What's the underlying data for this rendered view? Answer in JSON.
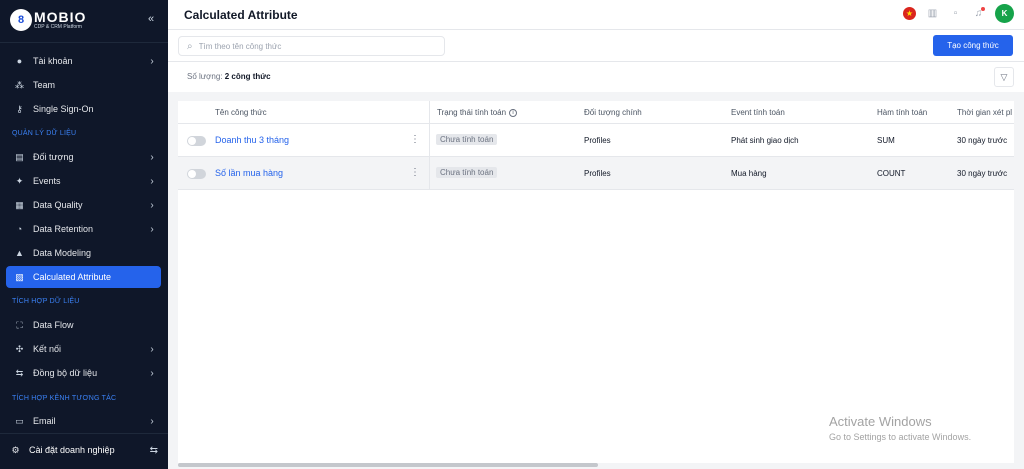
{
  "app": {
    "logo_name": "MOBIO",
    "logo_sub": "CDP & CRM Platform",
    "logo_mark": "8"
  },
  "sidebar": {
    "collapse_icon": "chevrons-left-icon",
    "items": [
      {
        "label": "Tài khoản",
        "icon": "user-icon"
      },
      {
        "label": "Team",
        "icon": "team-icon"
      },
      {
        "label": "Single Sign-On",
        "icon": "key-icon"
      },
      {
        "label": "Đối tượng",
        "icon": "object-icon"
      },
      {
        "label": "Events",
        "icon": "events-icon"
      },
      {
        "label": "Data Quality",
        "icon": "data-quality-icon"
      },
      {
        "label": "Data Retention",
        "icon": "data-retention-icon"
      },
      {
        "label": "Data Modeling",
        "icon": "data-modeling-icon"
      },
      {
        "label": "Calculated Attribute",
        "icon": "calculated-attribute-icon"
      },
      {
        "label": "Data Flow",
        "icon": "data-flow-icon"
      },
      {
        "label": "Kết nối",
        "icon": "connect-icon"
      },
      {
        "label": "Đồng bộ dữ liệu",
        "icon": "sync-icon"
      },
      {
        "label": "Email",
        "icon": "email-icon"
      }
    ],
    "sections": {
      "data_management": "QUẢN LÝ DỮ LIỆU",
      "data_integration": "TÍCH HỢP DỮ LIỆU",
      "channel_integration": "TÍCH HỢP KÊNH TƯƠNG TÁC"
    },
    "settings_label": "Cài đặt doanh nghiệp"
  },
  "header": {
    "title": "Calculated Attribute",
    "avatar_letter": "K",
    "colors": {
      "flag": "#da251d",
      "avatar": "#16a34a"
    }
  },
  "toolbar": {
    "search_placeholder": "Tìm theo tên công thức",
    "search_value": "",
    "create_label": "Tạo công thức",
    "accent": "#2563eb"
  },
  "summary": {
    "count_label": "Số lượng:",
    "count_value": "2 công thức"
  },
  "table": {
    "columns": [
      "Tên công thức",
      "Trạng thái tính toán",
      "Đối tượng chính",
      "Event tính toán",
      "Hàm tính toán",
      "Thời gian xét pl"
    ],
    "rows": [
      {
        "name": "Doanh thu 3 tháng",
        "status": "Chưa tính toán",
        "object": "Profiles",
        "event": "Phát sinh giao dịch",
        "func": "SUM",
        "time": "30 ngày trước",
        "enabled": false
      },
      {
        "name": "Số lần mua hàng",
        "status": "Chưa tính toán",
        "object": "Profiles",
        "event": "Mua hàng",
        "func": "COUNT",
        "time": "30 ngày trước",
        "enabled": false
      }
    ]
  },
  "watermark": {
    "line1": "Activate Windows",
    "line2": "Go to Settings to activate Windows."
  }
}
